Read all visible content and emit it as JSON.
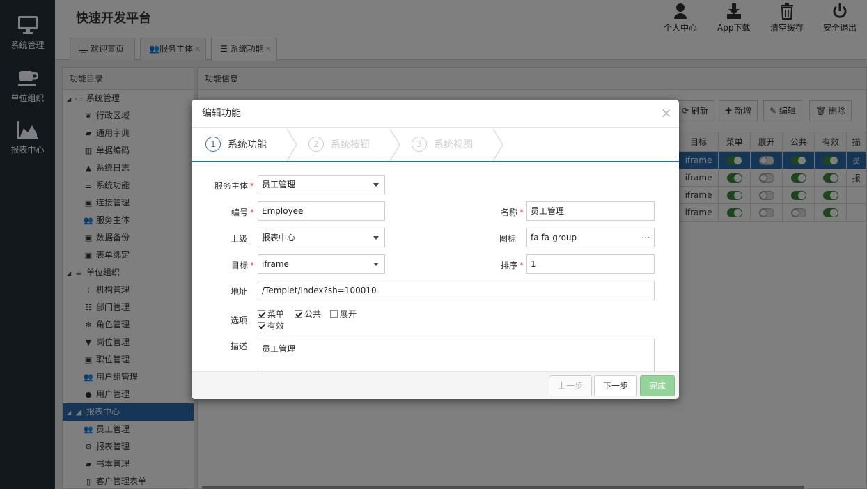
{
  "left_nav": {
    "items": [
      {
        "label": "系统管理",
        "icon": "monitor-icon"
      },
      {
        "label": "单位组织",
        "icon": "coffee-cup-icon"
      },
      {
        "label": "报表中心",
        "icon": "area-chart-icon"
      }
    ]
  },
  "header": {
    "title": "快速开发平台",
    "buttons": [
      {
        "label": "个人中心",
        "icon": "user-icon"
      },
      {
        "label": "App下载",
        "icon": "download-icon"
      },
      {
        "label": "清空缓存",
        "icon": "trash-icon"
      },
      {
        "label": "安全退出",
        "icon": "power-icon"
      }
    ]
  },
  "tabs": [
    {
      "label": "欢迎首页",
      "closable": false
    },
    {
      "label": "服务主体",
      "closable": true
    },
    {
      "label": "系统功能",
      "closable": true,
      "active": true
    }
  ],
  "tree": {
    "title": "功能目录",
    "items": [
      {
        "label": "系统管理",
        "level": 0,
        "icon": "monitor-icon"
      },
      {
        "label": "行政区域",
        "level": 1,
        "icon": "leaf-icon"
      },
      {
        "label": "通用字典",
        "level": 1,
        "icon": "book-icon"
      },
      {
        "label": "单据编码",
        "level": 1,
        "icon": "barcode-icon"
      },
      {
        "label": "系统日志",
        "level": 1,
        "icon": "warning-icon"
      },
      {
        "label": "系统功能",
        "level": 1,
        "icon": "list-icon"
      },
      {
        "label": "连接管理",
        "level": 1,
        "icon": "briefcase-icon"
      },
      {
        "label": "服务主体",
        "level": 1,
        "icon": "users-icon"
      },
      {
        "label": "数据备份",
        "level": 1,
        "icon": "briefcase-icon"
      },
      {
        "label": "表单绑定",
        "level": 1,
        "icon": "briefcase-icon"
      },
      {
        "label": "单位组织",
        "level": 0,
        "icon": "coffee-cup-icon"
      },
      {
        "label": "机构管理",
        "level": 1,
        "icon": "sitemap-icon"
      },
      {
        "label": "部门管理",
        "level": 1,
        "icon": "th-list-icon"
      },
      {
        "label": "角色管理",
        "level": 1,
        "icon": "paw-icon"
      },
      {
        "label": "岗位管理",
        "level": 1,
        "icon": "graduation-cap-icon"
      },
      {
        "label": "职位管理",
        "level": 1,
        "icon": "briefcase-icon"
      },
      {
        "label": "用户组管理",
        "level": 1,
        "icon": "users-icon"
      },
      {
        "label": "用户管理",
        "level": 1,
        "icon": "user-icon"
      },
      {
        "label": "报表中心",
        "level": 0,
        "icon": "area-chart-icon",
        "selected": true
      },
      {
        "label": "员工管理",
        "level": 1,
        "icon": "users-icon"
      },
      {
        "label": "报表管理",
        "level": 1,
        "icon": "cogs-icon"
      },
      {
        "label": "书本管理",
        "level": 1,
        "icon": "book-icon"
      },
      {
        "label": "客户管理表单",
        "level": 1,
        "icon": "file-icon"
      }
    ]
  },
  "main_panel": {
    "title": "功能信息",
    "toolbar": [
      {
        "label": "刷新",
        "icon": "refresh-icon"
      },
      {
        "label": "新增",
        "icon": "plus-icon"
      },
      {
        "label": "编辑",
        "icon": "edit-icon"
      },
      {
        "label": "删除",
        "icon": "trash-icon"
      }
    ],
    "columns": [
      "目标",
      "菜单",
      "展开",
      "公共",
      "有效",
      "描"
    ],
    "rows": [
      {
        "target": "iframe",
        "menu": true,
        "expand": false,
        "public": true,
        "valid": true,
        "desc": "员",
        "selected": true
      },
      {
        "target": "iframe",
        "menu": true,
        "expand": false,
        "public": true,
        "valid": true,
        "desc": "报"
      },
      {
        "target": "iframe",
        "menu": true,
        "expand": false,
        "public": true,
        "valid": true,
        "desc": ""
      },
      {
        "target": "iframe",
        "menu": true,
        "expand": false,
        "public": false,
        "valid": true,
        "desc": ""
      }
    ]
  },
  "modal": {
    "title": "编辑功能",
    "steps": [
      {
        "num": "1",
        "label": "系统功能",
        "state": "done"
      },
      {
        "num": "2",
        "label": "系统按钮",
        "state": "todo"
      },
      {
        "num": "3",
        "label": "系统视图",
        "state": "todo"
      }
    ],
    "form": {
      "service_label": "服务主体",
      "service_value": "员工管理",
      "code_label": "编号",
      "code_value": "Employee",
      "name_label": "名称",
      "name_value": "员工管理",
      "parent_label": "上级",
      "parent_value": "报表中心",
      "icon_label": "图标",
      "icon_value": "fa fa-group",
      "icon_more": "···",
      "target_label": "目标",
      "target_value": "iframe",
      "order_label": "排序",
      "order_value": "1",
      "url_label": "地址",
      "url_value": "/Templet/Index?sh=100010",
      "options_label": "选项",
      "options": [
        {
          "label": "菜单",
          "checked": true
        },
        {
          "label": "公共",
          "checked": true
        },
        {
          "label": "展开",
          "checked": false
        },
        {
          "label": "有效",
          "checked": true
        }
      ],
      "desc_label": "描述",
      "desc_value": "员工管理"
    },
    "footer": {
      "prev": "上一步",
      "next": "下一步",
      "finish": "完成"
    }
  }
}
